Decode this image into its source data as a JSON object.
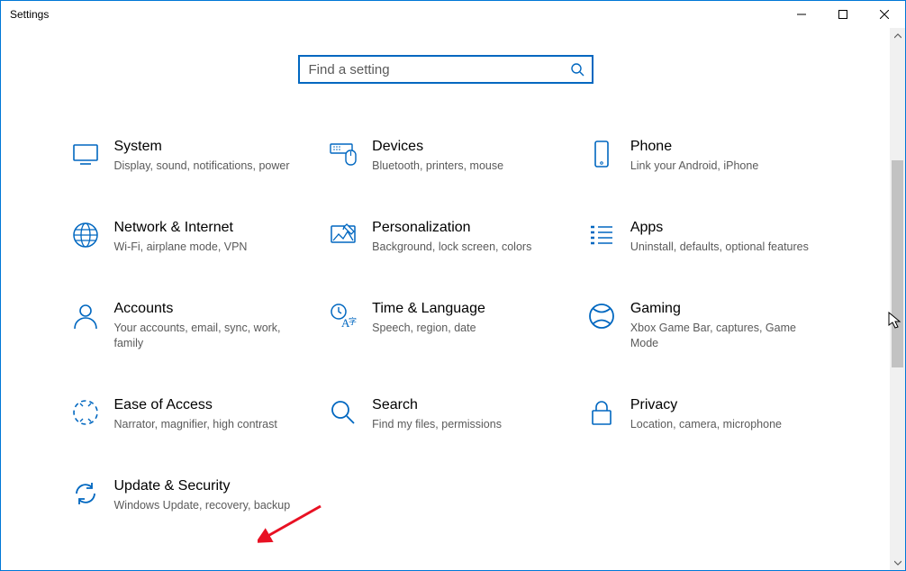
{
  "window": {
    "title": "Settings"
  },
  "search": {
    "placeholder": "Find a setting"
  },
  "categories": [
    {
      "id": "system",
      "title": "System",
      "desc": "Display, sound, notifications, power"
    },
    {
      "id": "devices",
      "title": "Devices",
      "desc": "Bluetooth, printers, mouse"
    },
    {
      "id": "phone",
      "title": "Phone",
      "desc": "Link your Android, iPhone"
    },
    {
      "id": "network",
      "title": "Network & Internet",
      "desc": "Wi-Fi, airplane mode, VPN"
    },
    {
      "id": "personalization",
      "title": "Personalization",
      "desc": "Background, lock screen, colors"
    },
    {
      "id": "apps",
      "title": "Apps",
      "desc": "Uninstall, defaults, optional features"
    },
    {
      "id": "accounts",
      "title": "Accounts",
      "desc": "Your accounts, email, sync, work, family"
    },
    {
      "id": "time",
      "title": "Time & Language",
      "desc": "Speech, region, date"
    },
    {
      "id": "gaming",
      "title": "Gaming",
      "desc": "Xbox Game Bar, captures, Game Mode"
    },
    {
      "id": "ease",
      "title": "Ease of Access",
      "desc": "Narrator, magnifier, high contrast"
    },
    {
      "id": "search",
      "title": "Search",
      "desc": "Find my files, permissions"
    },
    {
      "id": "privacy",
      "title": "Privacy",
      "desc": "Location, camera, microphone"
    },
    {
      "id": "update",
      "title": "Update & Security",
      "desc": "Windows Update, recovery, backup"
    }
  ]
}
